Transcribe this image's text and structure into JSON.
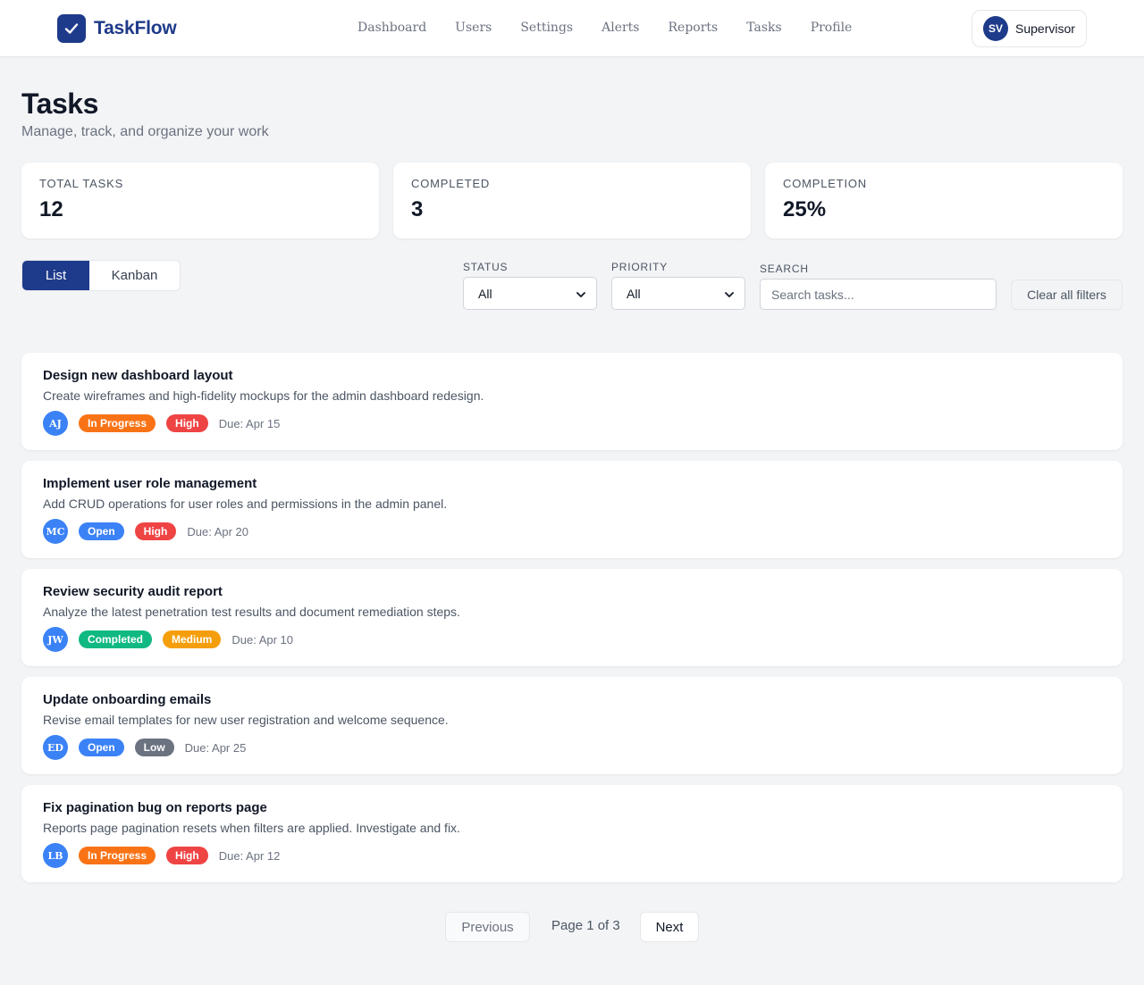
{
  "app": {
    "name": "TaskFlow",
    "logo_icon": "check-icon",
    "accent": "#1e3a8a"
  },
  "nav": {
    "items": [
      {
        "label": "Dashboard"
      },
      {
        "label": "Users"
      },
      {
        "label": "Settings"
      },
      {
        "label": "Alerts"
      },
      {
        "label": "Reports"
      },
      {
        "label": "Tasks"
      },
      {
        "label": "Profile"
      }
    ]
  },
  "user": {
    "initials": "SV",
    "name": "Supervisor"
  },
  "page": {
    "title": "Tasks",
    "subtitle": "Manage, track, and organize your work"
  },
  "stats": [
    {
      "label": "Total Tasks",
      "value": "12"
    },
    {
      "label": "Completed",
      "value": "3"
    },
    {
      "label": "Completion",
      "value": "25%"
    }
  ],
  "view_toggle": {
    "list": "List",
    "kanban": "Kanban",
    "active": "list"
  },
  "filters": {
    "status_label": "Status",
    "status_value": "All",
    "priority_label": "Priority",
    "priority_value": "All",
    "search_label": "Search",
    "search_placeholder": "Search tasks...",
    "clear_label": "Clear all filters"
  },
  "status_colors": {
    "In Progress": "#f97316",
    "Open": "#3b82f6",
    "Completed": "#10b981"
  },
  "priority_colors": {
    "High": "#ef4444",
    "Medium": "#f59e0b",
    "Low": "#6b7280"
  },
  "tasks": [
    {
      "title": "Design new dashboard layout",
      "description": "Create wireframes and high-fidelity mockups for the admin dashboard redesign.",
      "assignee": "AJ",
      "status": "In Progress",
      "priority": "High",
      "due": "Due: Apr 15"
    },
    {
      "title": "Implement user role management",
      "description": "Add CRUD operations for user roles and permissions in the admin panel.",
      "assignee": "MC",
      "status": "Open",
      "priority": "High",
      "due": "Due: Apr 20"
    },
    {
      "title": "Review security audit report",
      "description": "Analyze the latest penetration test results and document remediation steps.",
      "assignee": "JW",
      "status": "Completed",
      "priority": "Medium",
      "due": "Due: Apr 10"
    },
    {
      "title": "Update onboarding emails",
      "description": "Revise email templates for new user registration and welcome sequence.",
      "assignee": "ED",
      "status": "Open",
      "priority": "Low",
      "due": "Due: Apr 25"
    },
    {
      "title": "Fix pagination bug on reports page",
      "description": "Reports page pagination resets when filters are applied. Investigate and fix.",
      "assignee": "LB",
      "status": "In Progress",
      "priority": "High",
      "due": "Due: Apr 12"
    }
  ],
  "pagination": {
    "previous": "Previous",
    "info": "Page 1 of 3",
    "next": "Next"
  }
}
